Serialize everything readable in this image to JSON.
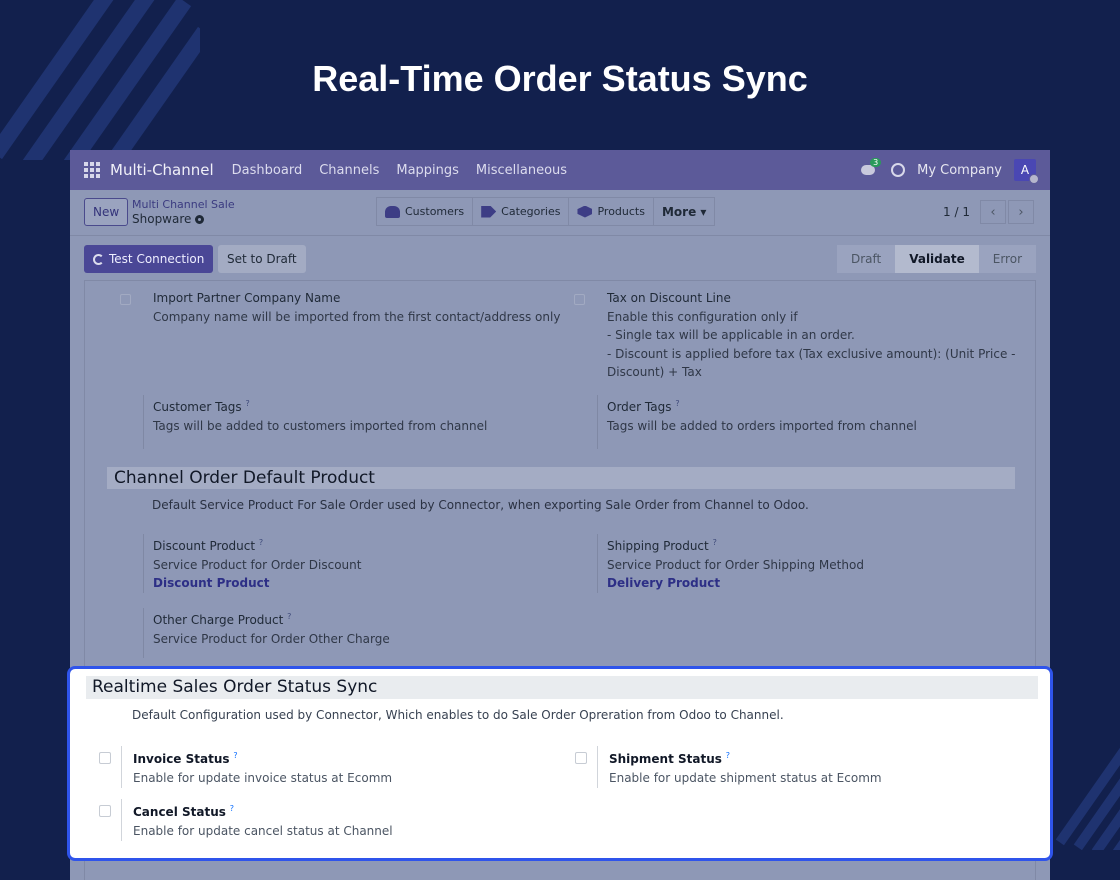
{
  "page_title": "Real-Time Order Status Sync",
  "navbar": {
    "brand": "Multi-Channel",
    "items": [
      "Dashboard",
      "Channels",
      "Mappings",
      "Miscellaneous"
    ],
    "chat_count": "3",
    "company": "My Company",
    "avatar_letter": "A"
  },
  "control_panel": {
    "new_label": "New",
    "breadcrumb": "Multi Channel Sale",
    "record_name": "Shopware",
    "smart_buttons": [
      "Customers",
      "Categories",
      "Products",
      "More ▾"
    ],
    "pager": "1 / 1",
    "prev": "‹",
    "next": "›"
  },
  "status_bar": {
    "test_connection": "Test Connection",
    "set_to_draft": "Set to Draft",
    "stages": [
      "Draft",
      "Validate",
      "Error"
    ],
    "active_stage": "Validate"
  },
  "form": {
    "import_partner": {
      "label": "Import Partner Company Name",
      "help": "Company name will be imported from the first contact/address only"
    },
    "tax_discount": {
      "label": "Tax on Discount Line",
      "lines": [
        "Enable this configuration only if",
        "- Single tax will be applicable in an order.",
        "- Discount is applied before tax (Tax exclusive amount): (Unit Price -",
        "Discount) + Tax"
      ]
    },
    "customer_tags": {
      "label": "Customer Tags",
      "help": "Tags will be added to customers imported from channel"
    },
    "order_tags": {
      "label": "Order Tags",
      "help": "Tags will be added to orders imported from channel"
    },
    "default_product": {
      "title": "Channel Order Default Product",
      "desc": "Default Service Product For Sale Order used by Connector, when exporting Sale Order from Channel to Odoo.",
      "discount": {
        "label": "Discount Product",
        "help": "Service Product for Order Discount",
        "value": "Discount Product"
      },
      "shipping": {
        "label": "Shipping Product",
        "help": "Service Product for Order Shipping Method",
        "value": "Delivery Product"
      },
      "other": {
        "label": "Other Charge Product",
        "help": "Service Product for Order Other Charge"
      }
    },
    "help_mark": "?"
  },
  "realtime": {
    "title": "Realtime Sales Order Status Sync",
    "desc": "Default Configuration used by Connector, Which enables to do Sale Order Opreration from Odoo to Channel.",
    "invoice": {
      "label": "Invoice Status",
      "help": "Enable for update invoice status at Ecomm"
    },
    "shipment": {
      "label": "Shipment Status",
      "help": "Enable for update shipment status at Ecomm"
    },
    "cancel": {
      "label": "Cancel Status",
      "help": "Enable for update cancel status at Channel"
    }
  }
}
